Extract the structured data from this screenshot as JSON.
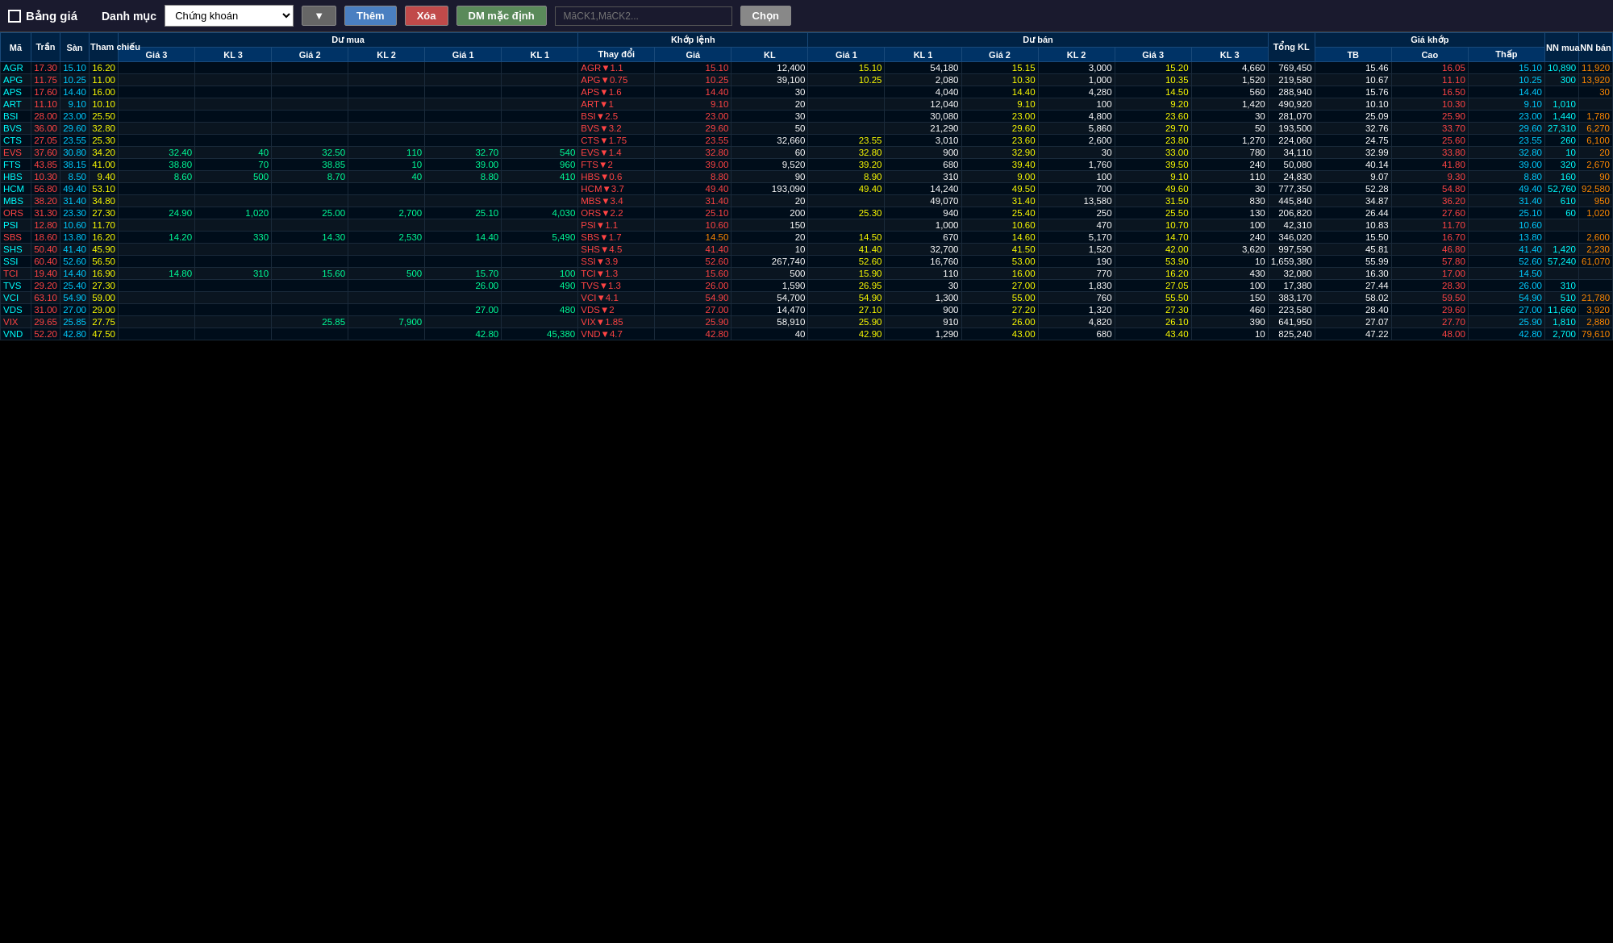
{
  "topbar": {
    "title": "Bảng giá",
    "danh_muc": "Danh mục",
    "category_value": "Chứng khoán",
    "btn_them": "Thêm",
    "btn_xoa": "Xóa",
    "btn_dm": "DM mặc định",
    "placeholder": "MāCK1,MāCK2...",
    "btn_chon": "Chọn"
  },
  "headers": {
    "ma": "Mã",
    "tran": "Trần",
    "san": "Sàn",
    "tham_chieu": "Tham chiếu",
    "du_mua": "Dư mua",
    "gia3": "Giá 3",
    "kl3_buy": "KL 3",
    "gia2": "Giá 2",
    "kl2_buy": "KL 2",
    "gia1": "Giá 1",
    "kl1_buy": "KL 1",
    "khop_lenh": "Khớp lệnh",
    "thay_doi": "Thay đổi",
    "gia": "Giá",
    "kl": "KL",
    "du_ban": "Dư bán",
    "gia1_sell": "Giá 1",
    "kl1_sell": "KL 1",
    "gia2_sell": "Giá 2",
    "kl2_sell": "KL 2",
    "gia3_sell": "Giá 3",
    "kl3_sell": "KL 3",
    "tong_kl": "Tổng KL",
    "gia_khop": "Giá khớp",
    "tb": "TB",
    "cao": "Cao",
    "thap": "Thấp",
    "nn_mua": "NN mua",
    "nn_ban": "NN bán"
  },
  "rows": [
    {
      "ma": "AGR",
      "tran": "17.30",
      "san": "15.10",
      "tc": "16.20",
      "g3b": "",
      "k3b": "",
      "g2b": "",
      "k2b": "",
      "g1b": "",
      "k1b": "",
      "thay_doi": "AGR▼1.1",
      "gia": "15.10",
      "kl": "12,400",
      "g1s": "15.10",
      "k1s": "54,180",
      "g2s": "15.15",
      "k2s": "3,000",
      "g3s": "15.20",
      "k3s": "4,660",
      "tong_kl": "769,450",
      "tb": "15.46",
      "cao": "16.05",
      "thap": "15.10",
      "nn_mua": "10,890",
      "nn_ban": "11,920",
      "ma_color": "cyan",
      "tc_color": "yellow",
      "g_color": "red"
    },
    {
      "ma": "APG",
      "tran": "11.75",
      "san": "10.25",
      "tc": "11.00",
      "g3b": "",
      "k3b": "",
      "g2b": "",
      "k2b": "",
      "g1b": "",
      "k1b": "",
      "thay_doi": "APG▼0.75",
      "gia": "10.25",
      "kl": "39,100",
      "g1s": "10.25",
      "k1s": "2,080",
      "g2s": "10.30",
      "k2s": "1,000",
      "g3s": "10.35",
      "k3s": "1,520",
      "tong_kl": "219,580",
      "tb": "10.67",
      "cao": "11.10",
      "thap": "10.25",
      "nn_mua": "300",
      "nn_ban": "13,920",
      "ma_color": "cyan",
      "tc_color": "yellow",
      "g_color": "red"
    },
    {
      "ma": "APS",
      "tran": "17.60",
      "san": "14.40",
      "tc": "16.00",
      "g3b": "",
      "k3b": "",
      "g2b": "",
      "k2b": "",
      "g1b": "",
      "k1b": "",
      "thay_doi": "APS▼1.6",
      "gia": "14.40",
      "kl": "30",
      "g1s": "",
      "k1s": "4,040",
      "g2s": "14.40",
      "k2s": "4,280",
      "g3s": "14.50",
      "k3s": "560",
      "tong_kl": "288,940",
      "tb": "15.76",
      "cao": "16.50",
      "thap": "14.40",
      "nn_mua": "",
      "nn_ban": "30",
      "ma_color": "cyan",
      "tc_color": "yellow",
      "g_color": "red"
    },
    {
      "ma": "ART",
      "tran": "11.10",
      "san": "9.10",
      "tc": "10.10",
      "g3b": "",
      "k3b": "",
      "g2b": "",
      "k2b": "",
      "g1b": "",
      "k1b": "",
      "thay_doi": "ART▼1",
      "gia": "9.10",
      "kl": "20",
      "g1s": "",
      "k1s": "12,040",
      "g2s": "9.10",
      "k2s": "100",
      "g3s": "9.20",
      "k3s": "1,420",
      "tong_kl": "490,920",
      "tb": "10.10",
      "cao": "10.30",
      "thap": "9.10",
      "nn_mua": "1,010",
      "nn_ban": "",
      "ma_color": "cyan",
      "tc_color": "yellow",
      "g_color": "red"
    },
    {
      "ma": "BSI",
      "tran": "28.00",
      "san": "23.00",
      "tc": "25.50",
      "g3b": "",
      "k3b": "",
      "g2b": "",
      "k2b": "",
      "g1b": "",
      "k1b": "",
      "thay_doi": "BSI▼2.5",
      "gia": "23.00",
      "kl": "30",
      "g1s": "",
      "k1s": "30,080",
      "g2s": "23.00",
      "k2s": "4,800",
      "g3s": "23.60",
      "k3s": "30",
      "tong_kl": "281,070",
      "tb": "25.09",
      "cao": "25.90",
      "thap": "23.00",
      "nn_mua": "1,440",
      "nn_ban": "1,780",
      "ma_color": "cyan",
      "tc_color": "yellow",
      "g_color": "red"
    },
    {
      "ma": "BVS",
      "tran": "36.00",
      "san": "29.60",
      "tc": "32.80",
      "g3b": "",
      "k3b": "",
      "g2b": "",
      "k2b": "",
      "g1b": "",
      "k1b": "",
      "thay_doi": "BVS▼3.2",
      "gia": "29.60",
      "kl": "50",
      "g1s": "",
      "k1s": "21,290",
      "g2s": "29.60",
      "k2s": "5,860",
      "g3s": "29.70",
      "k3s": "50",
      "tong_kl": "193,500",
      "tb": "32.76",
      "cao": "33.70",
      "thap": "29.60",
      "nn_mua": "27,310",
      "nn_ban": "6,270",
      "ma_color": "cyan",
      "tc_color": "yellow",
      "g_color": "red"
    },
    {
      "ma": "CTS",
      "tran": "27.05",
      "san": "23.55",
      "tc": "25.30",
      "g3b": "",
      "k3b": "",
      "g2b": "",
      "k2b": "",
      "g1b": "",
      "k1b": "",
      "thay_doi": "CTS▼1.75",
      "gia": "23.55",
      "kl": "32,660",
      "g1s": "23.55",
      "k1s": "3,010",
      "g2s": "23.60",
      "k2s": "2,600",
      "g3s": "23.80",
      "k3s": "1,270",
      "tong_kl": "224,060",
      "tb": "24.75",
      "cao": "25.60",
      "thap": "23.55",
      "nn_mua": "260",
      "nn_ban": "6,100",
      "ma_color": "cyan",
      "tc_color": "yellow",
      "g_color": "red"
    },
    {
      "ma": "EVS",
      "tran": "37.60",
      "san": "30.80",
      "tc": "34.20",
      "g3b": "32.40",
      "k3b": "40",
      "g2b": "32.50",
      "k2b": "110",
      "g1b": "32.70",
      "k1b": "540",
      "thay_doi": "EVS▼1.4",
      "gia": "32.80",
      "kl": "60",
      "g1s": "32.80",
      "k1s": "900",
      "g2s": "32.90",
      "k2s": "30",
      "g3s": "33.00",
      "k3s": "780",
      "tong_kl": "34,110",
      "tb": "32.99",
      "cao": "33.80",
      "thap": "32.80",
      "nn_mua": "10",
      "nn_ban": "20",
      "ma_color": "red",
      "tc_color": "yellow",
      "g_color": "red"
    },
    {
      "ma": "FTS",
      "tran": "43.85",
      "san": "38.15",
      "tc": "41.00",
      "g3b": "38.80",
      "k3b": "70",
      "g2b": "38.85",
      "k2b": "10",
      "g1b": "39.00",
      "k1b": "960",
      "thay_doi": "FTS▼2",
      "gia": "39.00",
      "kl": "9,520",
      "g1s": "39.20",
      "k1s": "680",
      "g2s": "39.40",
      "k2s": "1,760",
      "g3s": "39.50",
      "k3s": "240",
      "tong_kl": "50,080",
      "tb": "40.14",
      "cao": "41.80",
      "thap": "39.00",
      "nn_mua": "320",
      "nn_ban": "2,670",
      "ma_color": "cyan",
      "tc_color": "yellow",
      "g_color": "red"
    },
    {
      "ma": "HBS",
      "tran": "10.30",
      "san": "8.50",
      "tc": "9.40",
      "g3b": "8.60",
      "k3b": "500",
      "g2b": "8.70",
      "k2b": "40",
      "g1b": "8.80",
      "k1b": "410",
      "thay_doi": "HBS▼0.6",
      "gia": "8.80",
      "kl": "90",
      "g1s": "8.90",
      "k1s": "310",
      "g2s": "9.00",
      "k2s": "100",
      "g3s": "9.10",
      "k3s": "110",
      "tong_kl": "24,830",
      "tb": "9.07",
      "cao": "9.30",
      "thap": "8.80",
      "nn_mua": "160",
      "nn_ban": "90",
      "ma_color": "cyan",
      "tc_color": "yellow",
      "g_color": "red"
    },
    {
      "ma": "HCM",
      "tran": "56.80",
      "san": "49.40",
      "tc": "53.10",
      "g3b": "",
      "k3b": "",
      "g2b": "",
      "k2b": "",
      "g1b": "",
      "k1b": "",
      "thay_doi": "HCM▼3.7",
      "gia": "49.40",
      "kl": "193,090",
      "g1s": "49.40",
      "k1s": "14,240",
      "g2s": "49.50",
      "k2s": "700",
      "g3s": "49.60",
      "k3s": "30",
      "tong_kl": "777,350",
      "tb": "52.28",
      "cao": "54.80",
      "thap": "49.40",
      "nn_mua": "52,760",
      "nn_ban": "92,580",
      "ma_color": "cyan",
      "tc_color": "yellow",
      "g_color": "red"
    },
    {
      "ma": "MBS",
      "tran": "38.20",
      "san": "31.40",
      "tc": "34.80",
      "g3b": "",
      "k3b": "",
      "g2b": "",
      "k2b": "",
      "g1b": "",
      "k1b": "",
      "thay_doi": "MBS▼3.4",
      "gia": "31.40",
      "kl": "20",
      "g1s": "",
      "k1s": "49,070",
      "g2s": "31.40",
      "k2s": "13,580",
      "g3s": "31.50",
      "k3s": "830",
      "tong_kl": "445,840",
      "tb": "34.87",
      "cao": "36.20",
      "thap": "31.40",
      "nn_mua": "610",
      "nn_ban": "950",
      "ma_color": "cyan",
      "tc_color": "yellow",
      "g_color": "red"
    },
    {
      "ma": "ORS",
      "tran": "31.30",
      "san": "23.30",
      "tc": "27.30",
      "g3b": "24.90",
      "k3b": "1,020",
      "g2b": "25.00",
      "k2b": "2,700",
      "g1b": "25.10",
      "k1b": "4,030",
      "thay_doi": "ORS▼2.2",
      "gia": "25.10",
      "kl": "200",
      "g1s": "25.30",
      "k1s": "940",
      "g2s": "25.40",
      "k2s": "250",
      "g3s": "25.50",
      "k3s": "130",
      "tong_kl": "206,820",
      "tb": "26.44",
      "cao": "27.60",
      "thap": "25.10",
      "nn_mua": "60",
      "nn_ban": "1,020",
      "ma_color": "red",
      "tc_color": "yellow",
      "g_color": "red"
    },
    {
      "ma": "PSI",
      "tran": "12.80",
      "san": "10.60",
      "tc": "11.70",
      "g3b": "",
      "k3b": "",
      "g2b": "",
      "k2b": "",
      "g1b": "",
      "k1b": "",
      "thay_doi": "PSI▼1.1",
      "gia": "10.60",
      "kl": "150",
      "g1s": "",
      "k1s": "1,000",
      "g2s": "10.60",
      "k2s": "470",
      "g3s": "10.70",
      "k3s": "100",
      "tong_kl": "42,310",
      "tb": "10.83",
      "cao": "11.70",
      "thap": "10.60",
      "nn_mua": "",
      "nn_ban": "",
      "ma_color": "cyan",
      "tc_color": "yellow",
      "g_color": "red"
    },
    {
      "ma": "SBS",
      "tran": "18.60",
      "san": "13.80",
      "tc": "16.20",
      "g3b": "14.20",
      "k3b": "330",
      "g2b": "14.30",
      "k2b": "2,530",
      "g1b": "14.40",
      "k1b": "5,490",
      "thay_doi": "SBS▼1.7",
      "gia": "14.50",
      "kl": "20",
      "g1s": "14.50",
      "k1s": "670",
      "g2s": "14.60",
      "k2s": "5,170",
      "g3s": "14.70",
      "k3s": "240",
      "tong_kl": "346,020",
      "tb": "15.50",
      "cao": "16.70",
      "thap": "13.80",
      "nn_mua": "",
      "nn_ban": "2,600",
      "ma_color": "red",
      "tc_color": "yellow",
      "g_color": "orange"
    },
    {
      "ma": "SHS",
      "tran": "50.40",
      "san": "41.40",
      "tc": "45.90",
      "g3b": "",
      "k3b": "",
      "g2b": "",
      "k2b": "",
      "g1b": "",
      "k1b": "",
      "thay_doi": "SHS▼4.5",
      "gia": "41.40",
      "kl": "10",
      "g1s": "41.40",
      "k1s": "32,700",
      "g2s": "41.50",
      "k2s": "1,520",
      "g3s": "42.00",
      "k3s": "3,620",
      "tong_kl": "997,590",
      "tb": "45.81",
      "cao": "46.80",
      "thap": "41.40",
      "nn_mua": "1,420",
      "nn_ban": "2,230",
      "ma_color": "cyan",
      "tc_color": "yellow",
      "g_color": "red"
    },
    {
      "ma": "SSI",
      "tran": "60.40",
      "san": "52.60",
      "tc": "56.50",
      "g3b": "",
      "k3b": "",
      "g2b": "",
      "k2b": "",
      "g1b": "",
      "k1b": "",
      "thay_doi": "SSI▼3.9",
      "gia": "52.60",
      "kl": "267,740",
      "g1s": "52.60",
      "k1s": "16,760",
      "g2s": "53.00",
      "k2s": "190",
      "g3s": "53.90",
      "k3s": "10",
      "tong_kl": "1,659,380",
      "tb": "55.99",
      "cao": "57.80",
      "thap": "52.60",
      "nn_mua": "57,240",
      "nn_ban": "61,070",
      "ma_color": "cyan",
      "tc_color": "yellow",
      "g_color": "red"
    },
    {
      "ma": "TCI",
      "tran": "19.40",
      "san": "14.40",
      "tc": "16.90",
      "g3b": "14.80",
      "k3b": "310",
      "g2b": "15.60",
      "k2b": "500",
      "g1b": "15.70",
      "k1b": "100",
      "thay_doi": "TCI▼1.3",
      "gia": "15.60",
      "kl": "500",
      "g1s": "15.90",
      "k1s": "110",
      "g2s": "16.00",
      "k2s": "770",
      "g3s": "16.20",
      "k3s": "430",
      "tong_kl": "32,080",
      "tb": "16.30",
      "cao": "17.00",
      "thap": "14.50",
      "nn_mua": "",
      "nn_ban": "",
      "ma_color": "red",
      "tc_color": "yellow",
      "g_color": "red"
    },
    {
      "ma": "TVS",
      "tran": "29.20",
      "san": "25.40",
      "tc": "27.30",
      "g3b": "",
      "k3b": "",
      "g2b": "",
      "k2b": "",
      "g1b": "26.00",
      "k1b": "490",
      "thay_doi": "TVS▼1.3",
      "gia": "26.00",
      "kl": "1,590",
      "g1s": "26.95",
      "k1s": "30",
      "g2s": "27.00",
      "k2s": "1,830",
      "g3s": "27.05",
      "k3s": "100",
      "tong_kl": "17,380",
      "tb": "27.44",
      "cao": "28.30",
      "thap": "26.00",
      "nn_mua": "310",
      "nn_ban": "",
      "ma_color": "cyan",
      "tc_color": "yellow",
      "g_color": "red"
    },
    {
      "ma": "VCI",
      "tran": "63.10",
      "san": "54.90",
      "tc": "59.00",
      "g3b": "",
      "k3b": "",
      "g2b": "",
      "k2b": "",
      "g1b": "",
      "k1b": "",
      "thay_doi": "VCI▼4.1",
      "gia": "54.90",
      "kl": "54,700",
      "g1s": "54.90",
      "k1s": "1,300",
      "g2s": "55.00",
      "k2s": "760",
      "g3s": "55.50",
      "k3s": "150",
      "tong_kl": "383,170",
      "tb": "58.02",
      "cao": "59.50",
      "thap": "54.90",
      "nn_mua": "510",
      "nn_ban": "21,780",
      "ma_color": "cyan",
      "tc_color": "yellow",
      "g_color": "red"
    },
    {
      "ma": "VDS",
      "tran": "31.00",
      "san": "27.00",
      "tc": "29.00",
      "g3b": "",
      "k3b": "",
      "g2b": "",
      "k2b": "",
      "g1b": "27.00",
      "k1b": "480",
      "thay_doi": "VDS▼2",
      "gia": "27.00",
      "kl": "14,470",
      "g1s": "27.10",
      "k1s": "900",
      "g2s": "27.20",
      "k2s": "1,320",
      "g3s": "27.30",
      "k3s": "460",
      "tong_kl": "223,580",
      "tb": "28.40",
      "cao": "29.60",
      "thap": "27.00",
      "nn_mua": "11,660",
      "nn_ban": "3,920",
      "ma_color": "cyan",
      "tc_color": "yellow",
      "g_color": "red"
    },
    {
      "ma": "VIX",
      "tran": "29.65",
      "san": "25.85",
      "tc": "27.75",
      "g3b": "",
      "k3b": "",
      "g2b": "25.85",
      "k2b": "7,900",
      "g1b": "",
      "k1b": "",
      "thay_doi": "VIX▼1.85",
      "gia": "25.90",
      "kl": "58,910",
      "g1s": "25.90",
      "k1s": "910",
      "g2s": "26.00",
      "k2s": "4,820",
      "g3s": "26.10",
      "k3s": "390",
      "tong_kl": "641,950",
      "tb": "27.07",
      "cao": "27.70",
      "thap": "25.90",
      "nn_mua": "1,810",
      "nn_ban": "2,880",
      "ma_color": "red",
      "tc_color": "yellow",
      "g_color": "red"
    },
    {
      "ma": "VND",
      "tran": "52.20",
      "san": "42.80",
      "tc": "47.50",
      "g3b": "",
      "k3b": "",
      "g2b": "",
      "k2b": "",
      "g1b": "42.80",
      "k1b": "45,380",
      "thay_doi": "VND▼4.7",
      "gia": "42.80",
      "kl": "40",
      "g1s": "42.90",
      "k1s": "1,290",
      "g2s": "43.00",
      "k2s": "680",
      "g3s": "43.40",
      "k3s": "10",
      "tong_kl": "825,240",
      "tb": "47.22",
      "cao": "48.00",
      "thap": "42.80",
      "nn_mua": "2,700",
      "nn_ban": "79,610",
      "ma_color": "cyan",
      "tc_color": "yellow",
      "g_color": "red"
    }
  ]
}
